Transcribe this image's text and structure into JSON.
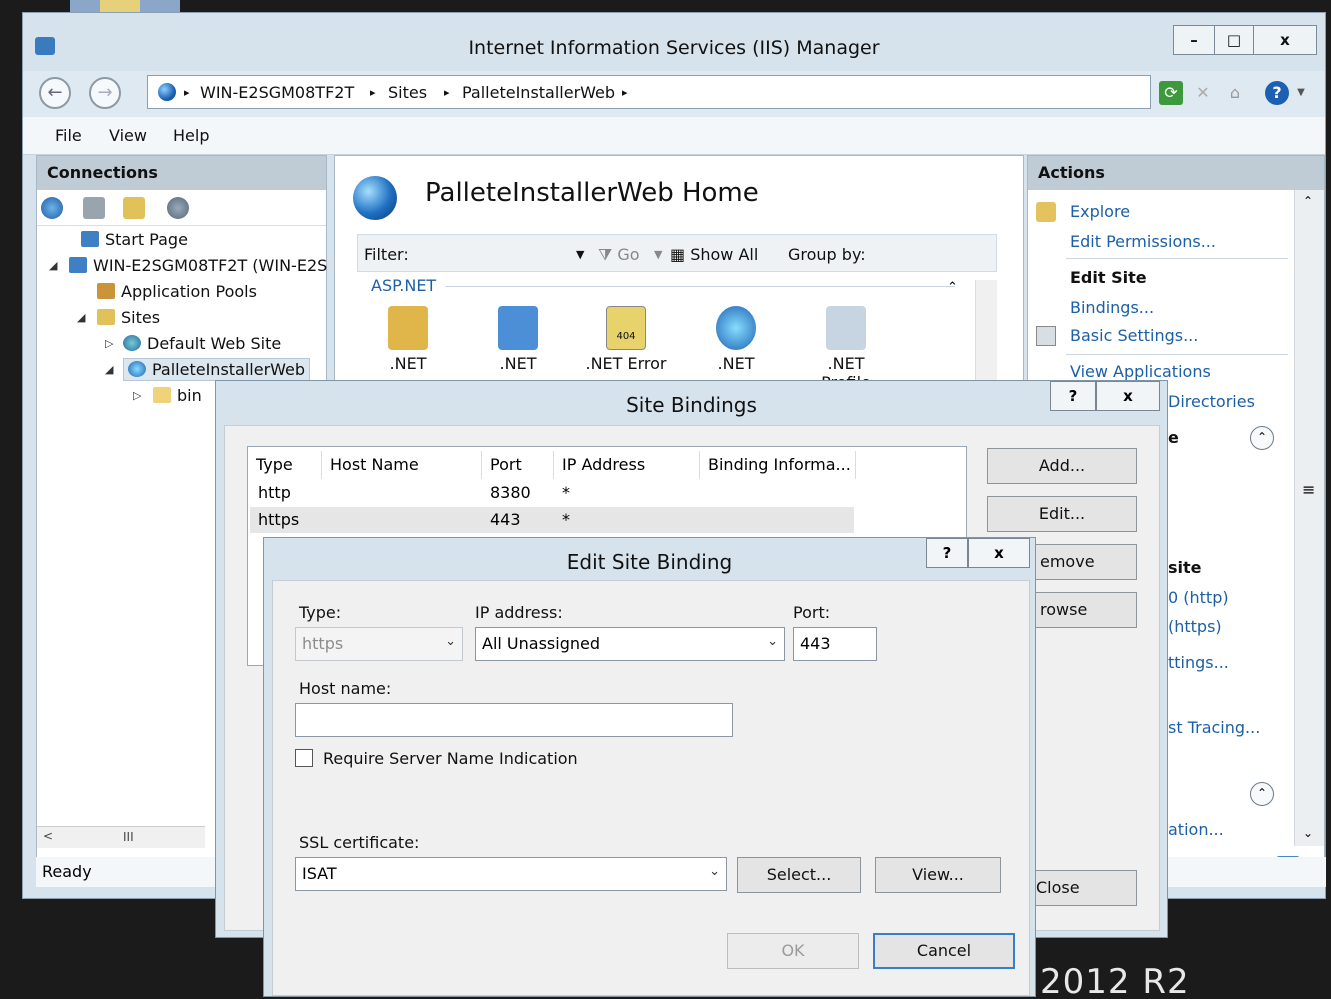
{
  "window": {
    "title": "Internet Information Services (IIS) Manager",
    "minimize": "–",
    "maximize": "□",
    "close": "x"
  },
  "address": {
    "crumbs": [
      "WIN-E2SGM08TF2T",
      "Sites",
      "PalleteInstallerWeb"
    ],
    "sep": "▸"
  },
  "menu": {
    "file": "File",
    "view": "View",
    "help": "Help"
  },
  "connections": {
    "title": "Connections",
    "items": [
      {
        "label": "Start Page"
      },
      {
        "label": "WIN-E2SGM08TF2T (WIN-E2S"
      },
      {
        "label": "Application Pools"
      },
      {
        "label": "Sites"
      },
      {
        "label": "Default Web Site"
      },
      {
        "label": "PalleteInstallerWeb"
      },
      {
        "label": "bin"
      }
    ],
    "scroll_glyph": "III"
  },
  "status": {
    "text": "Ready"
  },
  "center": {
    "title": "PalleteInstallerWeb Home",
    "filter_label": "Filter:",
    "go_label": "Go",
    "show_all_label": "Show All",
    "group_by_label": "Group by:",
    "group_name": "ASP.NET",
    "features": [
      ".NET",
      ".NET",
      ".NET Error",
      ".NET",
      ".NET Profile"
    ],
    "error_badge": "404"
  },
  "actions": {
    "title": "Actions",
    "explore": "Explore",
    "edit_permissions": "Edit Permissions...",
    "edit_site": "Edit Site",
    "bindings": "Bindings...",
    "basic_settings": "Basic Settings...",
    "view_applications": "View Applications",
    "view_directories_partial": "Directories",
    "partial_e": "e",
    "browse_head_partial": "site",
    "browse_http_partial": "0 (http)",
    "browse_https_partial": "(https)",
    "settings_partial": "ttings...",
    "tracing_partial": "st Tracing...",
    "config_partial": "ation...",
    "scroll_grip": "≡"
  },
  "site_bindings": {
    "title": "Site Bindings",
    "help": "?",
    "close": "x",
    "columns": [
      "Type",
      "Host Name",
      "Port",
      "IP Address",
      "Binding Informa..."
    ],
    "rows": [
      {
        "type": "http",
        "host": "",
        "port": "8380",
        "ip": "*",
        "info": ""
      },
      {
        "type": "https",
        "host": "",
        "port": "443",
        "ip": "*",
        "info": ""
      }
    ],
    "add": "Add...",
    "edit": "Edit...",
    "remove_partial": "emove",
    "browse_partial": "rowse",
    "close_btn_partial": "Close"
  },
  "edit_binding": {
    "title": "Edit Site Binding",
    "help": "?",
    "close": "x",
    "type_label": "Type:",
    "type_value": "https",
    "ip_label": "IP address:",
    "ip_value": "All Unassigned",
    "port_label": "Port:",
    "port_value": "443",
    "host_label": "Host name:",
    "host_value": "",
    "sni_label": "Require Server Name Indication",
    "sni_checked": false,
    "ssl_label": "SSL certificate:",
    "ssl_value": "ISAT",
    "select_btn": "Select...",
    "view_btn": "View...",
    "ok_btn": "OK",
    "cancel_btn": "Cancel"
  },
  "desktop": {
    "watermark_partial": "2012 R2"
  }
}
